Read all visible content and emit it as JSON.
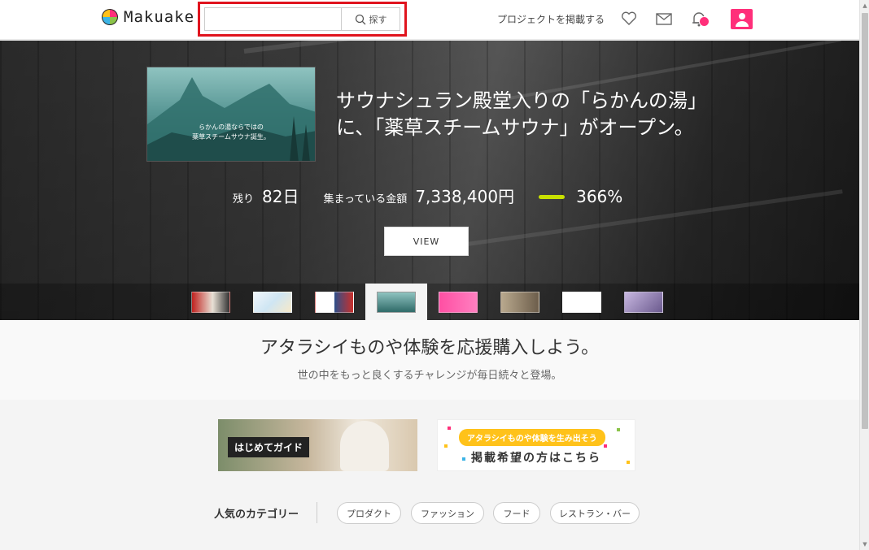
{
  "header": {
    "logo_text": "Makuake",
    "search": {
      "value": "",
      "placeholder": "",
      "button_label": "探す"
    },
    "post_project_link": "プロジェクトを掲載する",
    "icons": [
      "heart-icon",
      "mail-icon",
      "bell-icon",
      "user-icon"
    ]
  },
  "hero": {
    "title_line1": "サウナシュラン殿堂入りの「らかんの湯」",
    "title_line2": "に、「薬草スチームサウナ」がオープン。",
    "feature_image_text1": "らかんの湯ならではの",
    "feature_image_text2": "薬草スチームサウナ誕生。",
    "stats": {
      "remaining_label": "残り",
      "remaining_value": "82日",
      "raised_label": "集まっている金額",
      "raised_value": "7,338,400円",
      "percent_value": "366%"
    },
    "progress_fraction": 1.0,
    "view_button": "VIEW",
    "thumbnails_count": 8,
    "active_thumbnail_index": 3
  },
  "tagline": {
    "heading": "アタラシイものや体験を応援購入しよう。",
    "subheading": "世の中をもっと良くするチャレンジが毎日続々と登場。"
  },
  "banners": {
    "guide_label": "はじめてガイド",
    "post_pill": "アタラシイものや体験を生み出そう",
    "post_big": "掲載希望の方はこちら"
  },
  "categories": {
    "title": "人気のカテゴリー",
    "items": [
      "プロダクト",
      "ファッション",
      "フード",
      "レストラン・バー"
    ]
  },
  "colors": {
    "accent_pink": "#ff2f7a",
    "progress_lime": "#c8e000",
    "highlight_red": "#e0141e",
    "pill_yellow": "#ffc21a"
  }
}
